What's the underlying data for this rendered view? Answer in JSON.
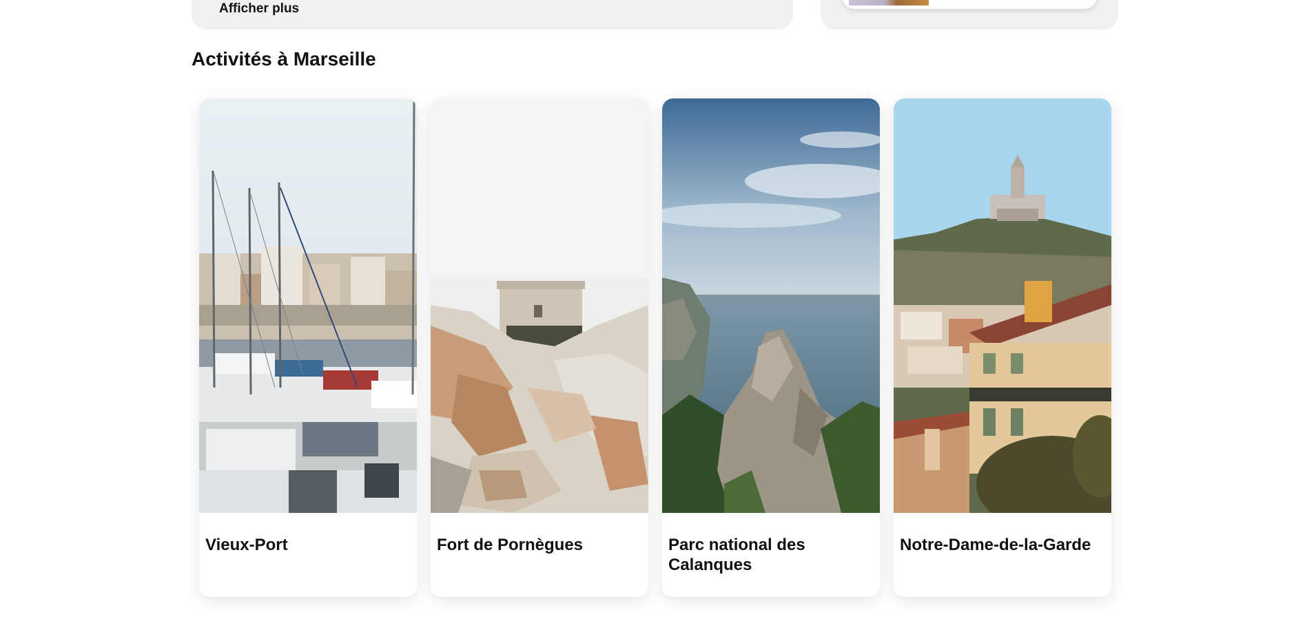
{
  "top_panel": {
    "show_more_label": "Afficher plus"
  },
  "section": {
    "title": "Activités à Marseille"
  },
  "cards": [
    {
      "title": "Vieux-Port"
    },
    {
      "title": "Fort de Pornègues"
    },
    {
      "title": "Parc national des Calanques"
    },
    {
      "title": "Notre-Dame-de-la-Garde"
    }
  ]
}
